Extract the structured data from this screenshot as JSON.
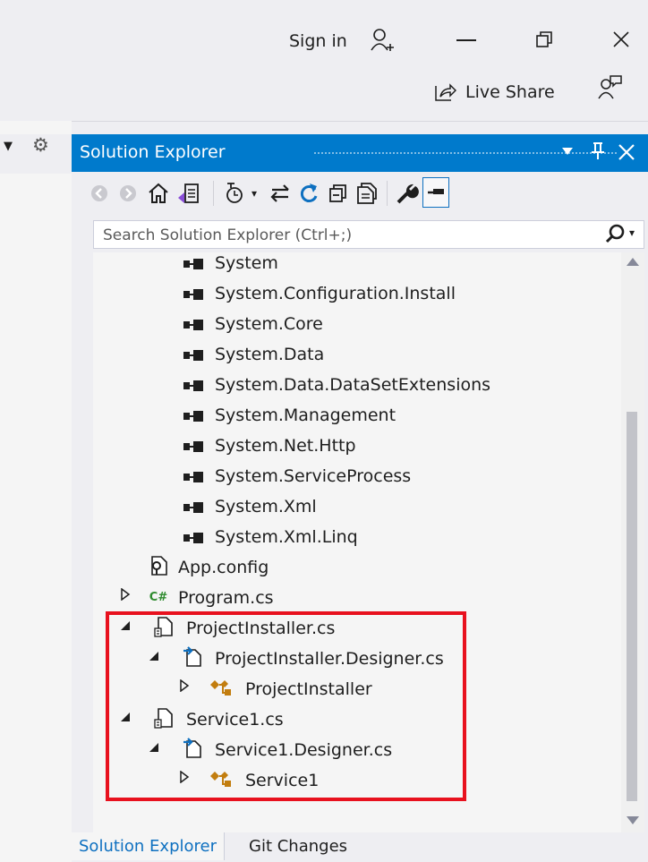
{
  "titlebar": {
    "sign_in": "Sign in",
    "live_share": "Live Share",
    "icons": [
      "add-user-icon",
      "minimize-icon",
      "restore-icon",
      "close-icon",
      "live-share-icon",
      "feedback-icon"
    ]
  },
  "solution_explorer": {
    "title": "Solution Explorer",
    "search_placeholder": "Search Solution Explorer (Ctrl+;)",
    "toolbar_icons": [
      "back-icon",
      "forward-icon",
      "home-icon",
      "switch-views-icon",
      "pending-changes-filter-icon",
      "sync-icon",
      "refresh-icon",
      "collapse-all-icon",
      "show-all-files-icon",
      "properties-icon",
      "preview-icon"
    ],
    "references": [
      "System",
      "System.Configuration.Install",
      "System.Core",
      "System.Data",
      "System.Data.DataSetExtensions",
      "System.Management",
      "System.Net.Http",
      "System.ServiceProcess",
      "System.Xml",
      "System.Xml.Linq"
    ],
    "files": {
      "app_config": "App.config",
      "program_cs": "Program.cs",
      "project_installer_cs": "ProjectInstaller.cs",
      "project_installer_designer": "ProjectInstaller.Designer.cs",
      "project_installer_class": "ProjectInstaller",
      "service1_cs": "Service1.cs",
      "service1_designer": "Service1.Designer.cs",
      "service1_class": "Service1"
    },
    "csharp_badge": "C#"
  },
  "tabs": {
    "solution_explorer": "Solution Explorer",
    "git_changes": "Git Changes"
  },
  "colors": {
    "accent": "#007acc",
    "highlight": "#e8111e",
    "class_icon": "#c27d0e"
  }
}
